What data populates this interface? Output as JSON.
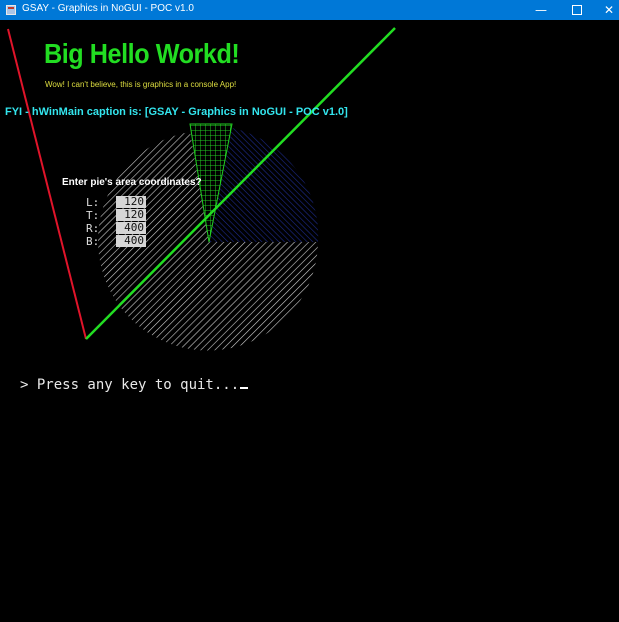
{
  "window": {
    "title": "GSAY - Graphics in NoGUI - POC v1.0",
    "minimize_glyph": "—",
    "close_glyph": "✕"
  },
  "console": {
    "big_title": "Big Hello Workd!",
    "subtitle": "Wow! I can't believe, this is graphics in a console App!",
    "fyi": "FYI - hWinMain caption is: [GSAY - Graphics in NoGUI - POC v1.0]",
    "prompt": "Enter pie's area coordinates?",
    "coords": [
      {
        "label": "L:",
        "value": "120"
      },
      {
        "label": "T:",
        "value": "120"
      },
      {
        "label": "R:",
        "value": "400"
      },
      {
        "label": "B:",
        "value": "400"
      }
    ],
    "quit": "> Press any key to quit..."
  },
  "colors": {
    "title_green": "#22dd22",
    "subtitle_yellow": "#dede40",
    "fyi_cyan": "#33e5ee",
    "red_line": "#e0142a",
    "green_line": "#22dd22",
    "pie_hatch_white": "#cfcfcf",
    "pie_hatch_blue": "#1c2a8c",
    "pie_grid_green": "#22cc22",
    "titlebar_blue": "#0078d7"
  }
}
